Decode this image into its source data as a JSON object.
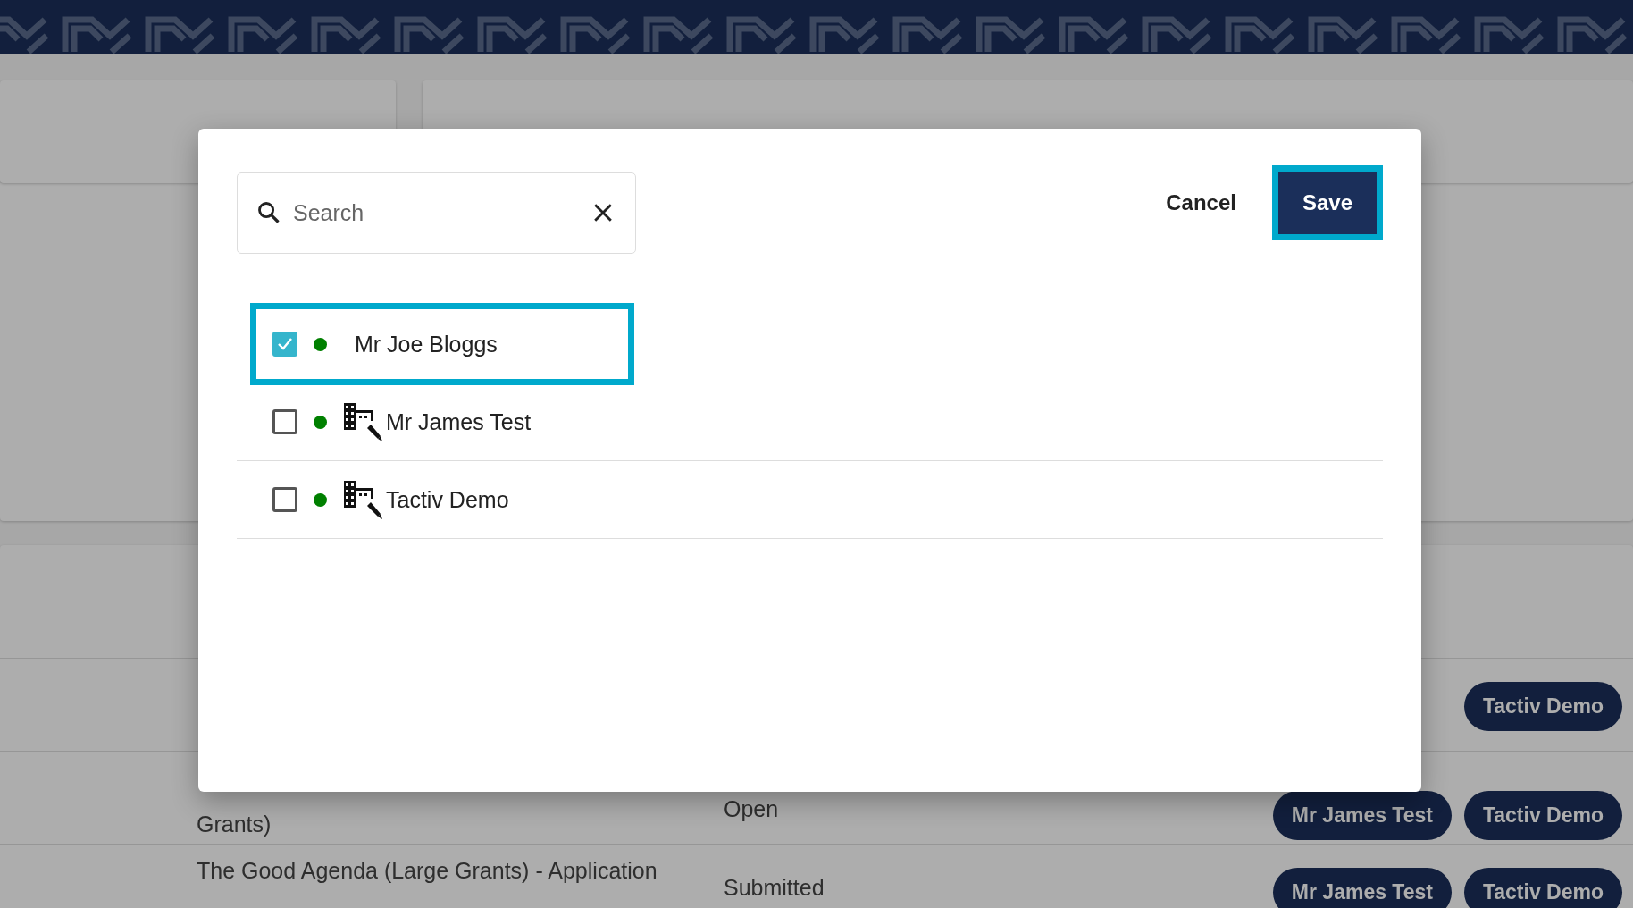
{
  "page": {
    "table_rows": [
      {
        "title": "",
        "status": "",
        "chips": [
          "Tactiv Demo"
        ]
      },
      {
        "title": "Grants)",
        "status": "Open",
        "chips": [
          "Mr James Test",
          "Tactiv Demo"
        ]
      },
      {
        "title": "The Good Agenda (Large Grants) - Application",
        "status": "Submitted",
        "chips": [
          "Mr James Test",
          "Tactiv Demo"
        ]
      }
    ]
  },
  "dialog": {
    "search": {
      "placeholder": "Search"
    },
    "buttons": [
      {
        "label": "Cancel",
        "kind": "text",
        "focused": false
      },
      {
        "label": "Save",
        "kind": "primary",
        "focused": true
      }
    ],
    "items": [
      {
        "name": "Mr Joe Bloggs",
        "kind": "person",
        "checked": true,
        "focused": true,
        "color": "#008000"
      },
      {
        "name": "Mr James Test",
        "kind": "organisation",
        "checked": false,
        "focused": false,
        "color": "#008000"
      },
      {
        "name": "Tactiv Demo",
        "kind": "organisation",
        "checked": false,
        "focused": false,
        "color": "#008000"
      }
    ]
  }
}
